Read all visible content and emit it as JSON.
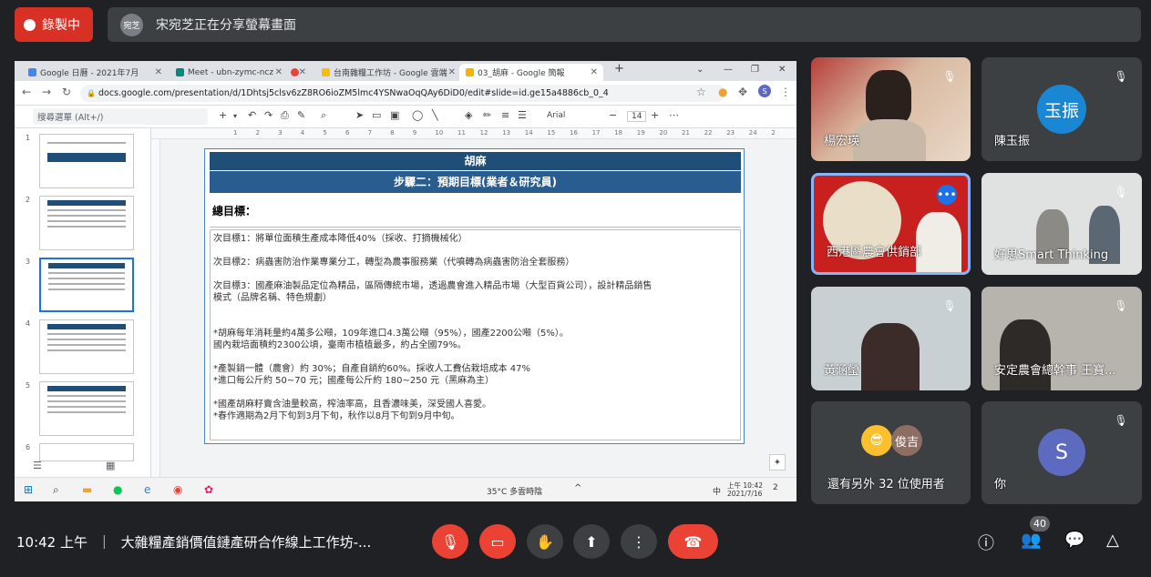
{
  "recording": {
    "label": "錄製中"
  },
  "presenter": {
    "avatar_text": "宛芝",
    "text": "宋宛芝正在分享螢幕畫面"
  },
  "browser": {
    "tabs": [
      {
        "title": "Google 日曆 - 2021年7月",
        "favicon_color": "#4285f4"
      },
      {
        "title": "Meet - ubn-zymc-ncz",
        "favicon_color": "#00897b"
      },
      {
        "title": "",
        "favicon_color": "#ea4335"
      },
      {
        "title": "台南雜糧工作坊 - Google 雲端",
        "favicon_color": "#fbbc04"
      },
      {
        "title": "03_胡麻 - Google 簡報",
        "favicon_color": "#f4b400"
      }
    ],
    "url": "docs.google.com/presentation/d/1Dhtsj5clsv6zZ8RO6ioZM5lmc4YSNwaOqQAy6DiD0/edit#slide=id.ge15a4886cb_0_4",
    "menu_search_placeholder": "搜尋選單 (Alt+/)",
    "font_name": "Arial",
    "font_size": "14",
    "zoom_label": "+"
  },
  "ruler_marks": [
    "1",
    "2",
    "3",
    "4",
    "5",
    "6",
    "7",
    "8",
    "9",
    "10",
    "11",
    "12",
    "13",
    "14",
    "15",
    "16",
    "17",
    "18",
    "19",
    "20",
    "21",
    "22",
    "23",
    "24",
    "2"
  ],
  "thumbnail_numbers": [
    "1",
    "2",
    "3",
    "4",
    "5",
    "6"
  ],
  "slide": {
    "title": "胡麻",
    "subtitle": "步驟二：預期目標(業者＆研究員)",
    "goal_heading": "總目標：",
    "body": [
      "次目標1：將單位面積生產成本降低40%（採收、打摘機械化）",
      "",
      "次目標2：病蟲害防治作業專業分工，轉型為農事服務業（代噴轉為病蟲害防治全套服務）",
      "",
      "次目標3：國產麻油製品定位為精品，區隔傳統市場，透過農會進入精品市場（大型百貨公司），設計精品銷售",
      "模式（品牌名稱、特色規劃）",
      "",
      "",
      "*胡麻每年消耗量約4萬多公噸，109年進口4.3萬公噸（95%），國產2200公噸（5%）。",
      "國內栽培面積約2300公頃，臺南市植植最多，約占全國79%。",
      "",
      "*產製銷一體（農會）約 30%；自產自銷約60%。採收人工費佔栽培成本 47%",
      "*進口每公斤約 50~70 元；國產每公斤約 180~250 元（黑麻為主）",
      "",
      "*國產胡麻籽賣含油量較高，榨油率高，且香濃味美，深受國人喜愛。",
      "*春作適期為2月下旬到3月下旬，秋作以8月下旬到9月中旬。"
    ]
  },
  "taskbar": {
    "weather": "35°C 多雲時陰",
    "ime": "中",
    "time": "上午 10:42",
    "date": "2021/7/16",
    "notifications": "2"
  },
  "participants": [
    {
      "name": "楊宏瑛",
      "muted": true
    },
    {
      "name": "陳玉振",
      "avatar_text": "玉振",
      "avatar_color": "#1a87d4",
      "muted": true
    },
    {
      "name": "西港區農會供銷部",
      "active": true
    },
    {
      "name": "好思Smart Thinking",
      "muted": true
    },
    {
      "name": "黃涵瑩",
      "muted": true
    },
    {
      "name": "安定農會總幹事 王寶...",
      "muted": true
    },
    {
      "name": "還有另外 32 位使用者",
      "others": [
        "俊吉"
      ]
    },
    {
      "name": "你",
      "avatar_text": "S",
      "avatar_color": "#5c6bc0",
      "muted": true
    }
  ],
  "meeting": {
    "time": "10:42 上午",
    "separator": "｜",
    "title": "大雜糧產銷價值鏈產研合作線上工作坊-...",
    "participant_count": "40"
  },
  "colors": {
    "end_call": "#ea4335",
    "brand_blue": "#1f4e79"
  }
}
